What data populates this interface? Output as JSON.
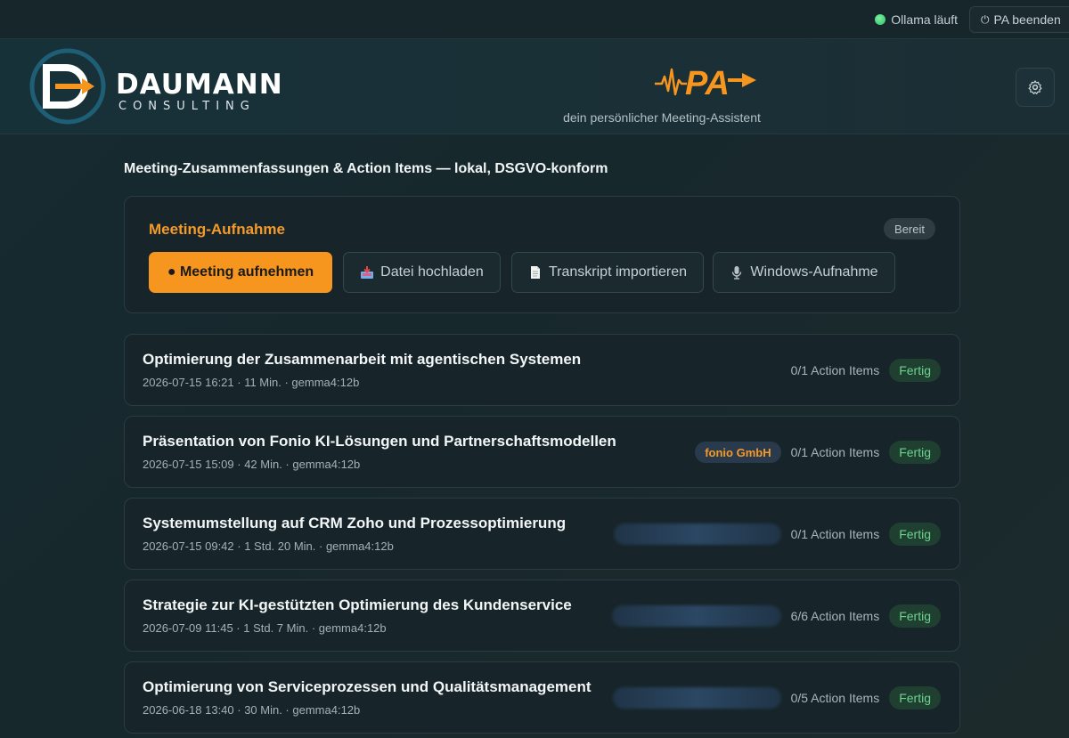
{
  "topbar": {
    "ollama_status": "Ollama läuft",
    "stop_label": "PA beenden"
  },
  "header": {
    "brand_name": "DAUMANN",
    "brand_sub": "CONSULTING",
    "pa_logo_text": "PA",
    "tagline": "dein persönlicher Meeting-Assistent"
  },
  "main": {
    "subtitle": "Meeting-Zusammenfassungen & Action Items — lokal, DSGVO-konform",
    "record": {
      "title": "Meeting-Aufnahme",
      "status": "Bereit",
      "buttons": [
        {
          "label": "● Meeting aufnehmen",
          "icon": "record-dot"
        },
        {
          "label": "Datei hochladen",
          "icon": "inbox-tray-icon"
        },
        {
          "label": "Transkript importieren",
          "icon": "document-icon"
        },
        {
          "label": "Windows-Aufnahme",
          "icon": "microphone-icon"
        }
      ]
    },
    "meetings": [
      {
        "title": "Optimierung der Zusammenarbeit mit agentischen Systemen",
        "meta": "2026-07-15 16:21 · 11 Min. · gemma4:12b",
        "company": "",
        "action_items": "0/1 Action Items",
        "status": "Fertig"
      },
      {
        "title": "Präsentation von Fonio KI-Lösungen und Partnerschaftsmodellen",
        "meta": "2026-07-15 15:09 · 42 Min. · gemma4:12b",
        "company": "fonio GmbH",
        "action_items": "0/1 Action Items",
        "status": "Fertig"
      },
      {
        "title": "Systemumstellung auf CRM Zoho und Prozessoptimierung",
        "meta": "2026-07-15 09:42 · 1 Std. 20 Min. · gemma4:12b",
        "company": "",
        "action_items": "0/1 Action Items",
        "status": "Fertig"
      },
      {
        "title": "Strategie zur KI-gestützten Optimierung des Kundenservice",
        "meta": "2026-07-09 11:45 · 1 Std. 7 Min. · gemma4:12b",
        "company": "",
        "action_items": "6/6 Action Items",
        "status": "Fertig"
      },
      {
        "title": "Optimierung von Serviceprozessen und Qualitätsmanagement",
        "meta": "2026-06-18 13:40 · 30 Min. · gemma4:12b",
        "company": "",
        "action_items": "0/5 Action Items",
        "status": "Fertig"
      }
    ]
  },
  "colors": {
    "accent": "#f7961e",
    "status_ok": "#6bd48f",
    "status_dot": "#3dd36f",
    "background": "#17282c"
  }
}
